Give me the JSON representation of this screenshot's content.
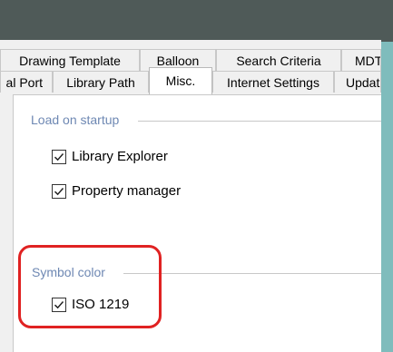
{
  "tabs_row1": [
    {
      "label": "Drawing Template"
    },
    {
      "label": "Balloon"
    },
    {
      "label": "Search Criteria"
    },
    {
      "label": "MDTo"
    }
  ],
  "tabs_row2": [
    {
      "label": "al Port"
    },
    {
      "label": "Library Path"
    },
    {
      "label": "Misc."
    },
    {
      "label": "Internet Settings"
    },
    {
      "label": "Update"
    }
  ],
  "active_tab": "Misc.",
  "groups": {
    "load_on_startup": {
      "label": "Load on startup",
      "items": [
        {
          "label": "Library Explorer",
          "checked": true
        },
        {
          "label": "Property manager",
          "checked": true
        }
      ]
    },
    "symbol_color": {
      "label": "Symbol color",
      "items": [
        {
          "label": "ISO 1219",
          "checked": true
        }
      ]
    }
  },
  "colors": {
    "titlebar": "#4f5a58",
    "group_label": "#6e88b3",
    "highlight": "#e02222",
    "background": "#7fbcbc"
  }
}
